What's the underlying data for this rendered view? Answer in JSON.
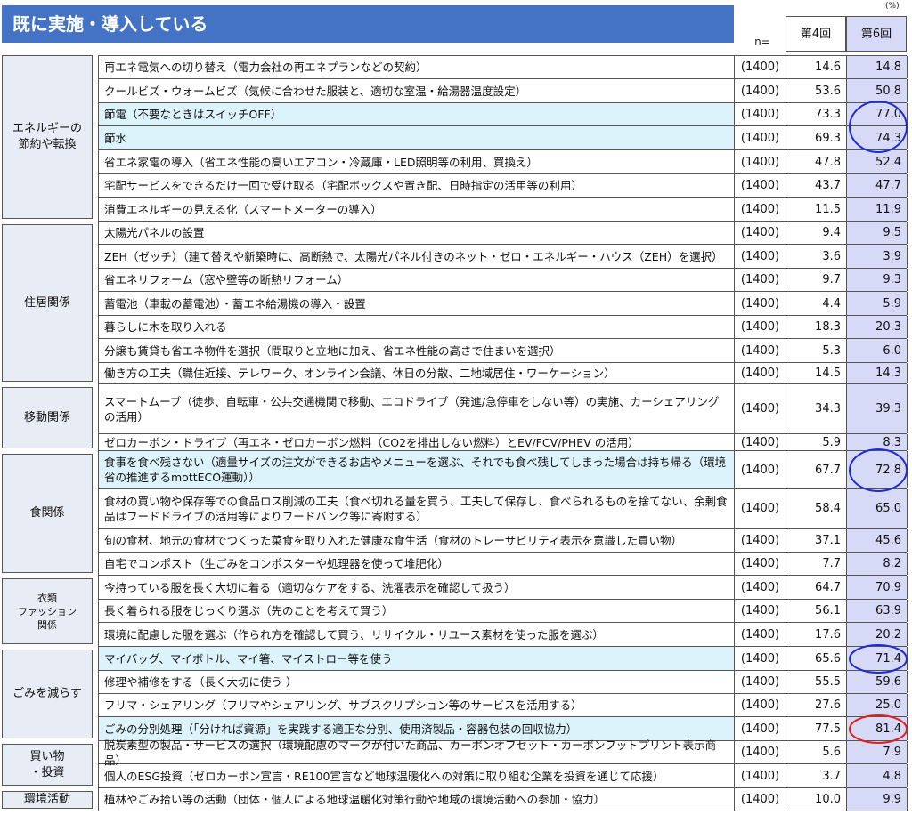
{
  "title": "既に実施・導入している",
  "unit": "(%)",
  "n_label": "n=",
  "headers": {
    "col4": "第4回",
    "col6": "第6回"
  },
  "colors": {
    "banner": "#4472c4",
    "highlight_row": "#ddf3fc",
    "col6_bg": "#d7daf7",
    "circle_blue": "#1f2bd6",
    "circle_red": "#e0201c"
  },
  "categories": [
    {
      "label": "エネルギーの\n節約や転換"
    },
    {
      "label": "住居関係"
    },
    {
      "label": "移動関係"
    },
    {
      "label": "食関係"
    },
    {
      "label": "衣類\nファッション\n関係"
    },
    {
      "label": "ごみを減らす"
    },
    {
      "label": "買い物\n・投資"
    },
    {
      "label": "環境活動"
    }
  ],
  "rows": [
    {
      "item": "再エネ電気への切り替え（電力会社の再エネプランなどの契約）",
      "n": "(1400)",
      "v4": "14.6",
      "v6": "14.8",
      "highlight": false,
      "circle": ""
    },
    {
      "item": "クールビズ・ウォームビズ（気候に合わせた服装と、適切な室温・給湯器温度設定）",
      "n": "(1400)",
      "v4": "53.6",
      "v6": "50.8",
      "highlight": false,
      "circle": ""
    },
    {
      "item": "節電（不要なときはスイッチOFF）",
      "n": "(1400)",
      "v4": "73.3",
      "v6": "77.0",
      "highlight": true,
      "circle": "blue"
    },
    {
      "item": "節水",
      "n": "(1400)",
      "v4": "69.3",
      "v6": "74.3",
      "highlight": true,
      "circle": "blue"
    },
    {
      "item": "省エネ家電の導入（省エネ性能の高いエアコン・冷蔵庫・LED照明等の利用、買換え）",
      "n": "(1400)",
      "v4": "47.8",
      "v6": "52.4",
      "highlight": false,
      "circle": ""
    },
    {
      "item": "宅配サービスをできるだけ一回で受け取る（宅配ボックスや置き配、日時指定の活用等の利用）",
      "n": "(1400)",
      "v4": "43.7",
      "v6": "47.7",
      "highlight": false,
      "circle": ""
    },
    {
      "item": "消費エネルギーの見える化（スマートメーターの導入）",
      "n": "(1400)",
      "v4": "11.5",
      "v6": "11.9",
      "highlight": false,
      "circle": ""
    },
    {
      "item": "太陽光パネルの設置",
      "n": "(1400)",
      "v4": "9.4",
      "v6": "9.5",
      "highlight": false,
      "circle": ""
    },
    {
      "item": "ZEH（ゼッチ）（建て替えや新築時に、高断熱で、太陽光パネル付きのネット・ゼロ・エネルギー・ハウス（ZEH）を選択）",
      "n": "(1400)",
      "v4": "3.6",
      "v6": "3.9",
      "highlight": false,
      "circle": ""
    },
    {
      "item": "省エネリフォーム（窓や壁等の断熱リフォーム）",
      "n": "(1400)",
      "v4": "9.7",
      "v6": "9.3",
      "highlight": false,
      "circle": ""
    },
    {
      "item": "蓄電池（車載の蓄電池）・蓄エネ給湯機の導入・設置",
      "n": "(1400)",
      "v4": "4.4",
      "v6": "5.9",
      "highlight": false,
      "circle": ""
    },
    {
      "item": "暮らしに木を取り入れる",
      "n": "(1400)",
      "v4": "18.3",
      "v6": "20.3",
      "highlight": false,
      "circle": ""
    },
    {
      "item": "分譲も賃貸も省エネ物件を選択（間取りと立地に加え、省エネ性能の高さで住まいを選択）",
      "n": "(1400)",
      "v4": "5.3",
      "v6": "6.0",
      "highlight": false,
      "circle": ""
    },
    {
      "item": "働き方の工夫（職住近接、テレワーク、オンライン会議、休日の分散、二地域居住・ワーケーション）",
      "n": "(1400)",
      "v4": "14.5",
      "v6": "14.3",
      "highlight": false,
      "circle": ""
    },
    {
      "item": "スマートムーブ（徒歩、自転車・公共交通機関で移動、エコドライブ（発進/急停車をしない等）の実施、カーシェアリングの活用）",
      "n": "(1400)",
      "v4": "34.3",
      "v6": "39.3",
      "highlight": false,
      "circle": ""
    },
    {
      "item": "ゼロカーボン・ドライブ（再エネ・ゼロカーボン燃料（CO2を排出しない燃料）とEV/FCV/PHEV の活用）",
      "n": "(1400)",
      "v4": "5.9",
      "v6": "8.3",
      "highlight": false,
      "circle": ""
    },
    {
      "item": "食事を食べ残さない（適量サイズの注文ができるお店やメニューを選ぶ、それでも食べ残してしまった場合は持ち帰る（環境省の推進するmottECO運動））",
      "n": "(1400)",
      "v4": "67.7",
      "v6": "72.8",
      "highlight": true,
      "circle": "blue"
    },
    {
      "item": "食材の買い物や保存等での食品ロス削減の工夫（食べ切れる量を買う、工夫して保存し、食べられるものを捨てない、余剰食品はフードドライブの活用等によりフードバンク等に寄附する）",
      "n": "(1400)",
      "v4": "58.4",
      "v6": "65.0",
      "highlight": false,
      "circle": ""
    },
    {
      "item": "旬の食材、地元の食材でつくった菜食を取り入れた健康な食生活（食材のトレーサビリティ表示を意識した買い物）",
      "n": "(1400)",
      "v4": "37.1",
      "v6": "45.6",
      "highlight": false,
      "circle": ""
    },
    {
      "item": "自宅でコンポスト（生ごみをコンポスターや処理器を使って堆肥化）",
      "n": "(1400)",
      "v4": "7.7",
      "v6": "8.2",
      "highlight": false,
      "circle": ""
    },
    {
      "item": "今持っている服を長く大切に着る（適切なケアをする、洗濯表示を確認して扱う）",
      "n": "(1400)",
      "v4": "64.7",
      "v6": "70.9",
      "highlight": false,
      "circle": ""
    },
    {
      "item": "長く着られる服をじっくり選ぶ（先のことを考えて買う）",
      "n": "(1400)",
      "v4": "56.1",
      "v6": "63.9",
      "highlight": false,
      "circle": ""
    },
    {
      "item": "環境に配慮した服を選ぶ（作られ方を確認して買う、リサイクル・リユース素材を使った服を選ぶ）",
      "n": "(1400)",
      "v4": "17.6",
      "v6": "20.2",
      "highlight": false,
      "circle": ""
    },
    {
      "item": "マイバッグ、マイボトル、マイ箸、マイストロー等を使う",
      "n": "(1400)",
      "v4": "65.6",
      "v6": "71.4",
      "highlight": true,
      "circle": "blue"
    },
    {
      "item": "修理や補修をする（長く大切に使う ）",
      "n": "(1400)",
      "v4": "55.5",
      "v6": "59.6",
      "highlight": false,
      "circle": ""
    },
    {
      "item": "フリマ・シェアリング（フリマやシェアリング、サブスクリプション等のサービスを活用する）",
      "n": "(1400)",
      "v4": "27.6",
      "v6": "25.0",
      "highlight": false,
      "circle": ""
    },
    {
      "item": "ごみの分別処理（「分ければ資源」を実践する適正な分別、使用済製品・容器包装の回収協力）",
      "n": "(1400)",
      "v4": "77.5",
      "v6": "81.4",
      "highlight": true,
      "circle": "red"
    },
    {
      "item": "脱炭素型の製品・サービスの選択（環境配慮のマークが付いた商品、カーボンオフセット・カーボンフットプリント表示商品）",
      "n": "(1400)",
      "v4": "5.6",
      "v6": "7.9",
      "highlight": false,
      "circle": ""
    },
    {
      "item": "個人のESG投資（ゼロカーボン宣言・RE100宣言など地球温暖化への対策に取り組む企業を投資を通じて応援）",
      "n": "(1400)",
      "v4": "3.7",
      "v6": "4.8",
      "highlight": false,
      "circle": ""
    },
    {
      "item": "植林やごみ拾い等の活動（団体・個人による地球温暖化対策行動や地域の環境活動への参加・協力）",
      "n": "(1400)",
      "v4": "10.0",
      "v6": "9.9",
      "highlight": false,
      "circle": ""
    }
  ]
}
